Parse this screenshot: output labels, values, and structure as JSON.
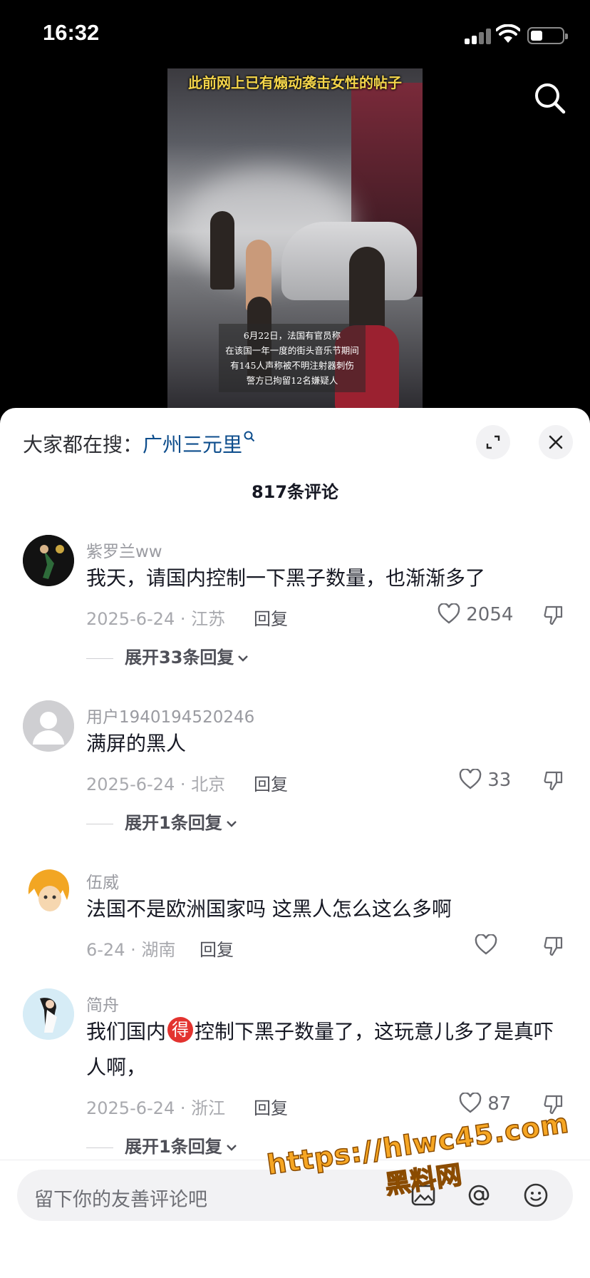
{
  "status_bar": {
    "time": "16:32"
  },
  "video": {
    "caption_top": "此前网上已有煽动袭击女性的帖子",
    "caption_lines": [
      "6月22日，法国有官员称",
      "在该国一年一度的街头音乐节期间",
      "有145人声称被不明注射器刺伤",
      "警方已拘留12名嫌疑人"
    ]
  },
  "sheet": {
    "trending_prefix": "大家都在搜：",
    "trending_keyword": "广州三元里",
    "comment_count": "817条评论"
  },
  "comments": [
    {
      "username": "紫罗兰ww",
      "text": "我天，请国内控制一下黑子数量，也渐渐多了",
      "meta": "2025-6-24 · 江苏",
      "reply_label": "回复",
      "likes": "2054",
      "expand": "展开33条回复"
    },
    {
      "username": "用户1940194520246",
      "text": "满屏的黑人",
      "meta": "2025-6-24 · 北京",
      "reply_label": "回复",
      "likes": "33",
      "expand": "展开1条回复"
    },
    {
      "username": "伍威",
      "text": "法国不是欧洲国家吗 这黑人怎么这么多啊",
      "meta": "6-24 · 湖南",
      "reply_label": "回复",
      "likes": ""
    },
    {
      "username": "简舟",
      "text_before": "我们国内",
      "badge": "得",
      "text_after": "控制下黑子数量了，这玩意儿多了是真吓人啊，",
      "meta": "2025-6-24 · 浙江",
      "reply_label": "回复",
      "likes": "87",
      "expand": "展开1条回复"
    }
  ],
  "input": {
    "placeholder": "留下你的友善评论吧"
  },
  "watermark": {
    "url": "https://hlwc45.com",
    "name": "黑料网"
  },
  "colors": {
    "keyword_blue": "#0d4d8c",
    "badge_red": "#e3332f",
    "watermark_orange": "#f6a623"
  }
}
